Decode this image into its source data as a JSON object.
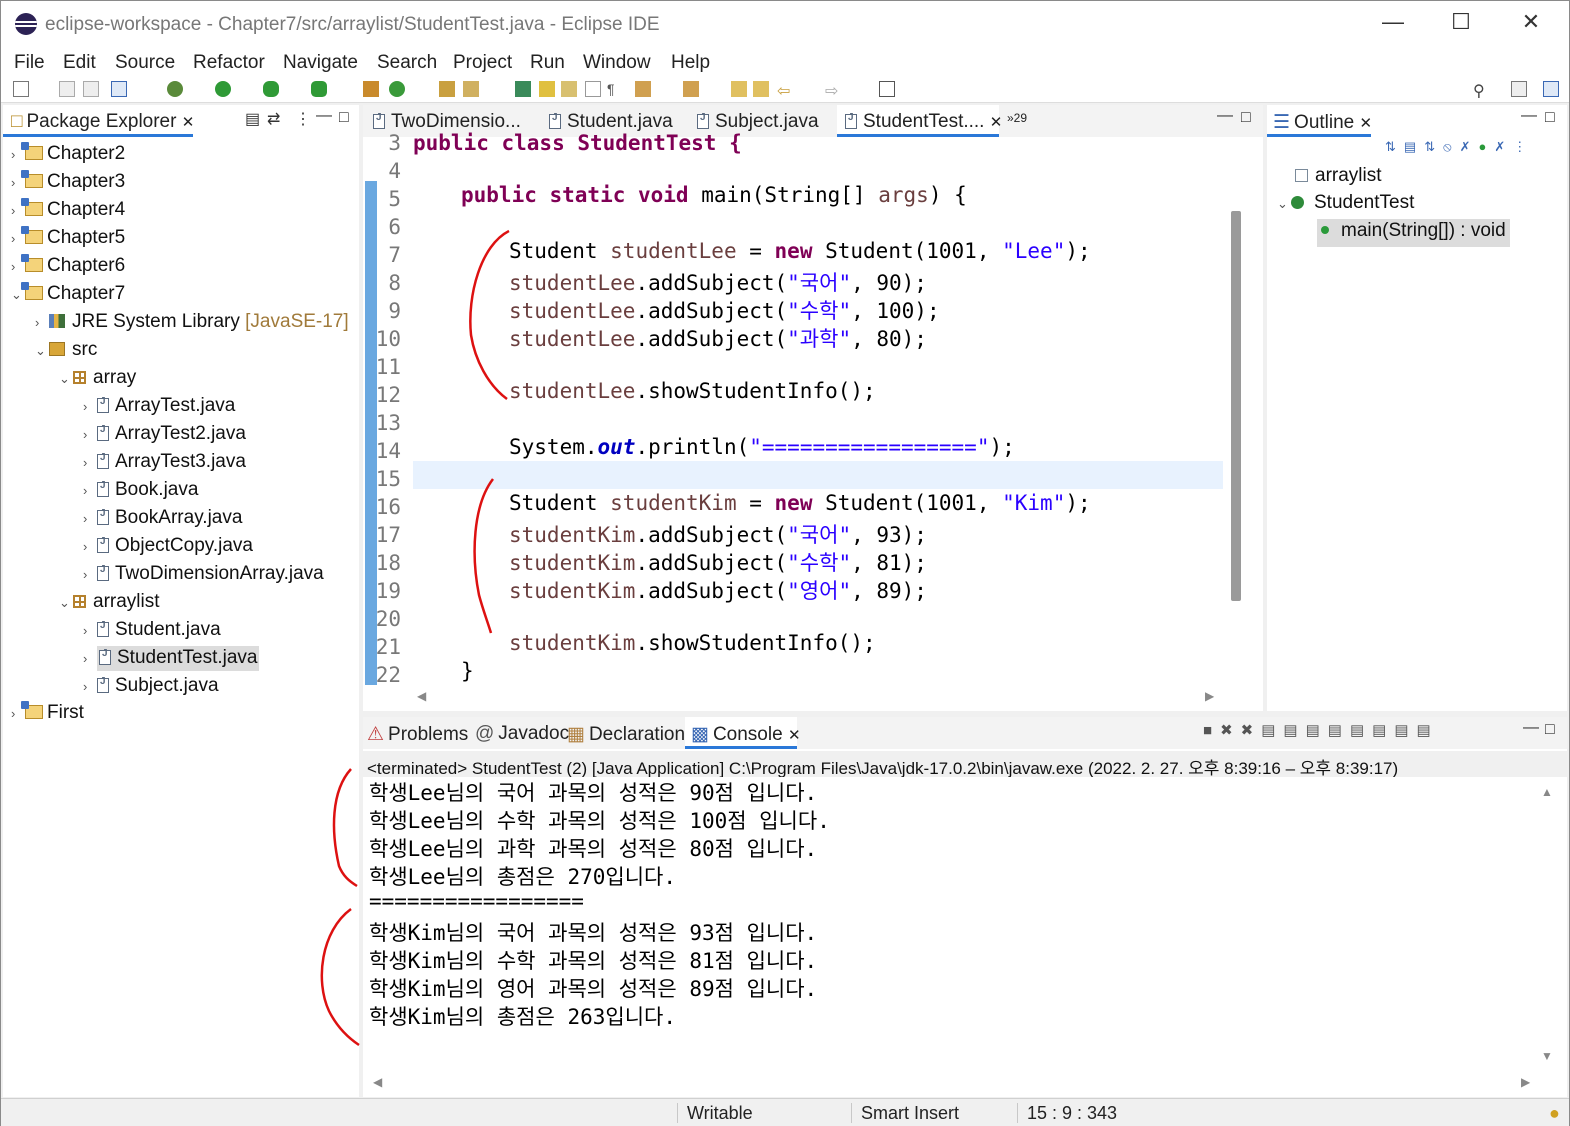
{
  "window": {
    "title": "eclipse-workspace - Chapter7/src/arraylist/StudentTest.java - Eclipse IDE"
  },
  "menu": [
    "File",
    "Edit",
    "Source",
    "Refactor",
    "Navigate",
    "Search",
    "Project",
    "Run",
    "Window",
    "Help"
  ],
  "package_explorer": {
    "title": "Package Explorer",
    "items": [
      {
        "label": "Chapter2"
      },
      {
        "label": "Chapter3"
      },
      {
        "label": "Chapter4"
      },
      {
        "label": "Chapter5"
      },
      {
        "label": "Chapter6"
      },
      {
        "label": "Chapter7"
      },
      {
        "label": "JRE System Library",
        "extra": "[JavaSE-17]"
      },
      {
        "label": "src"
      },
      {
        "label": "array"
      },
      {
        "label": "ArrayTest.java"
      },
      {
        "label": "ArrayTest2.java"
      },
      {
        "label": "ArrayTest3.java"
      },
      {
        "label": "Book.java"
      },
      {
        "label": "BookArray.java"
      },
      {
        "label": "ObjectCopy.java"
      },
      {
        "label": "TwoDimensionArray.java"
      },
      {
        "label": "arraylist"
      },
      {
        "label": "Student.java"
      },
      {
        "label": "StudentTest.java"
      },
      {
        "label": "Subject.java"
      },
      {
        "label": "First"
      }
    ]
  },
  "editor": {
    "tabs": [
      "TwoDimensio...",
      "Student.java",
      "Subject.java",
      "StudentTest....",
      "»29"
    ],
    "line_numbers": [
      "3",
      "4",
      "5",
      "6",
      "7",
      "8",
      "9",
      "10",
      "11",
      "12",
      "13",
      "14",
      "15",
      "16",
      "17",
      "18",
      "19",
      "20",
      "21",
      "22"
    ]
  },
  "code": {
    "l3": "public class StudentTest {",
    "l5a": "public static void ",
    "l5b": "main(String[] ",
    "l5c": "args",
    "l5d": ") {",
    "l7a": "Student ",
    "l7b": "studentLee",
    "l7c": " = ",
    "l7d": "new",
    "l7e": " Student(1001, ",
    "l7f": "\"Lee\"",
    "l7g": ");",
    "lee_var": "studentLee",
    "kim_var": "studentKim",
    "add": ".addSubject(",
    "show": ".showStudentInfo();",
    "s_kor": "\"국어\"",
    "s_math": "\"수학\"",
    "s_sci": "\"과학\"",
    "s_eng": "\"영어\"",
    "v8": ", 90);",
    "v9": ", 100);",
    "v10": ", 80);",
    "l14a": "System.",
    "l14b": "out",
    "l14c": ".println(",
    "l14d": "\"=================\"",
    "l14e": ");",
    "l16a": "Student ",
    "l16b": "studentKim",
    "l16c": " = ",
    "l16d": "new",
    "l16e": " Student(1001, ",
    "l16f": "\"Kim\"",
    "l16g": ");",
    "v17": ", 93);",
    "v18": ", 81);",
    "v19": ", 89);",
    "l22": "}"
  },
  "outline": {
    "title": "Outline",
    "pkg": "arraylist",
    "cls": "StudentTest",
    "method": "main(String[]) : void"
  },
  "bottom": {
    "tabs": [
      "Problems",
      "Javadoc",
      "Declaration",
      "Console"
    ],
    "terminated": "<terminated> StudentTest (2) [Java Application] C:\\Program Files\\Java\\jdk-17.0.2\\bin\\javaw.exe  (2022. 2. 27. 오후 8:39:16 – 오후 8:39:17)",
    "console_lines": [
      "학생Lee님의 국어 과목의 성적은 90점 입니다.",
      "학생Lee님의 수학 과목의 성적은 100점 입니다.",
      "학생Lee님의 과학 과목의 성적은 80점 입니다.",
      "학생Lee님의 총점은 270입니다.",
      "=================",
      "학생Kim님의 국어 과목의 성적은 93점 입니다.",
      "학생Kim님의 수학 과목의 성적은 81점 입니다.",
      "학생Kim님의 영어 과목의 성적은 89점 입니다.",
      "학생Kim님의 총점은 263입니다."
    ]
  },
  "status": {
    "writable": "Writable",
    "insert": "Smart Insert",
    "position": "15 : 9 : 343"
  },
  "colors": {
    "keyword": "#7f0055",
    "string": "#2a00ff",
    "variable": "#6a3e3e",
    "annotation": "#dd1111"
  }
}
